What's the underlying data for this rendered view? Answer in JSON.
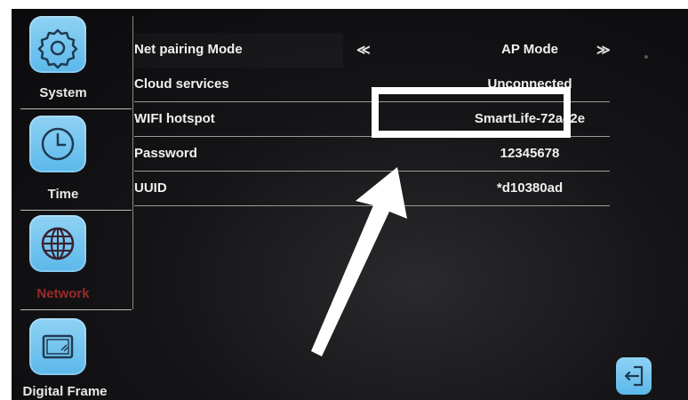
{
  "sidebar": {
    "items": [
      {
        "label": "System",
        "icon": "gear-icon",
        "active": false
      },
      {
        "label": "Time",
        "icon": "clock-icon",
        "active": false
      },
      {
        "label": "Network",
        "icon": "globe-icon",
        "active": true
      },
      {
        "label": "Digital Frame",
        "icon": "picture-frame-icon",
        "active": false
      }
    ]
  },
  "settings": {
    "rows": [
      {
        "label": "Net pairing Mode",
        "value": "AP Mode"
      },
      {
        "label": "Cloud services",
        "value": "Unconnected"
      },
      {
        "label": "WIFI hotspot",
        "value": "SmartLife-72a42e"
      },
      {
        "label": "Password",
        "value": "12345678"
      },
      {
        "label": "UUID",
        "value": "*d10380ad"
      }
    ],
    "prev_glyph": "≪",
    "next_glyph": "≫"
  },
  "colors": {
    "icon_bg": "#6ec3ee",
    "active_label": "#9b2a2a",
    "annotation": "#ffffff"
  }
}
